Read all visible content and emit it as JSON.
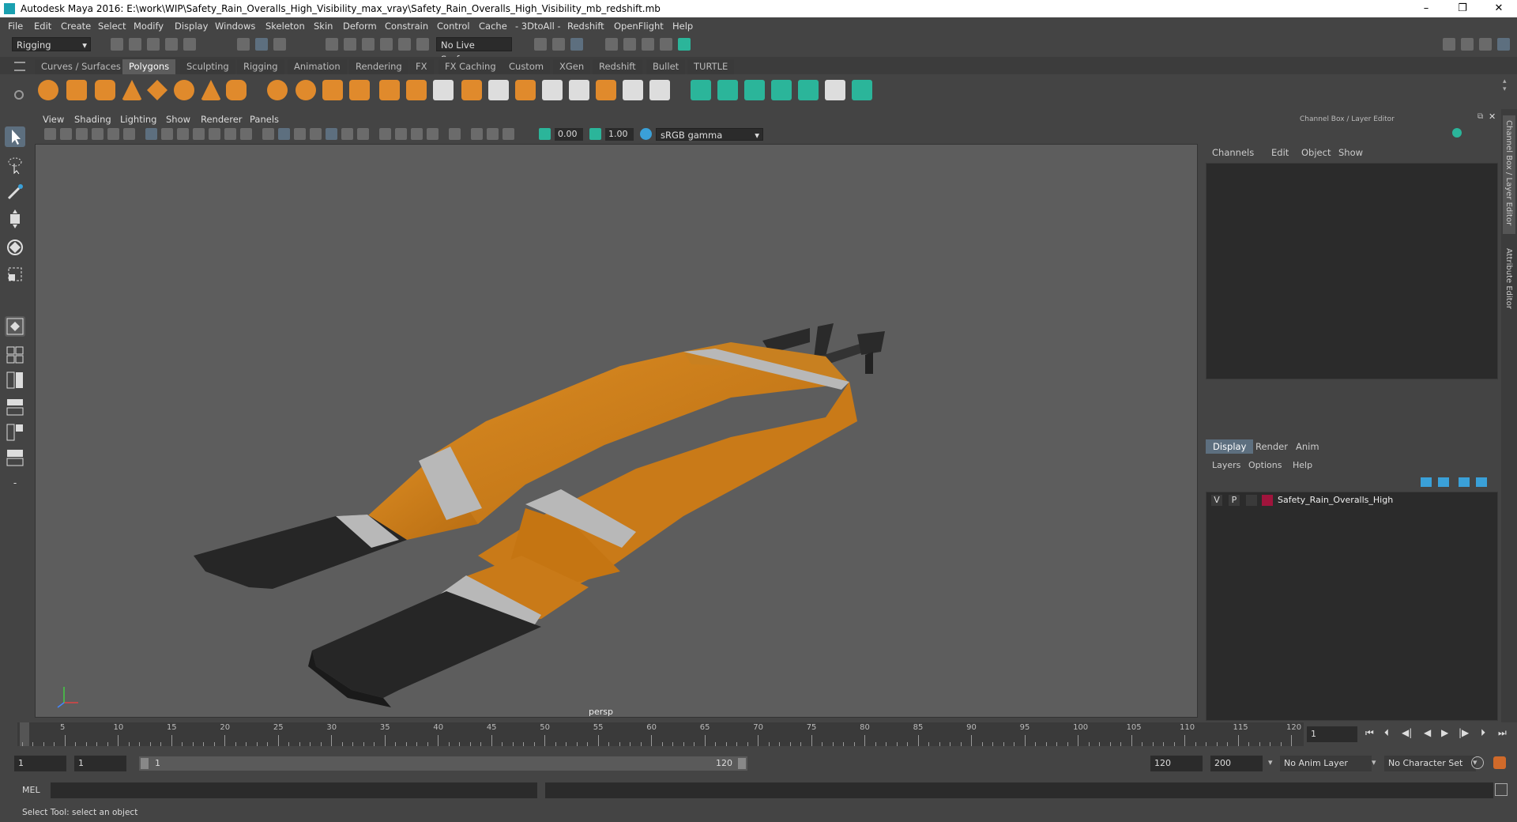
{
  "app": {
    "title": "Autodesk Maya 2016: E:\\work\\WIP\\Safety_Rain_Overalls_High_Visibility_max_vray\\Safety_Rain_Overalls_High_Visibility_mb_redshift.mb",
    "window_controls": [
      "–",
      "❐",
      "✕"
    ]
  },
  "menubar": [
    "File",
    "Edit",
    "Create",
    "Select",
    "Modify",
    "Display",
    "Windows",
    "Skeleton",
    "Skin",
    "Deform",
    "Constrain",
    "Control",
    "Cache",
    "- 3DtoAll -",
    "Redshift",
    "OpenFlight",
    "Help"
  ],
  "statusline": {
    "mode": "Rigging",
    "live_surface": "No Live Surface"
  },
  "shelf": {
    "tabs": [
      "Curves / Surfaces",
      "Polygons",
      "Sculpting",
      "Rigging",
      "Animation",
      "Rendering",
      "FX",
      "FX Caching",
      "Custom",
      "XGen",
      "Redshift",
      "Bullet",
      "TURTLE"
    ],
    "active_tab": "Polygons"
  },
  "viewport": {
    "menu": [
      "View",
      "Shading",
      "Lighting",
      "Show",
      "Renderer",
      "Panels"
    ],
    "exposure": "0.00",
    "gamma": "1.00",
    "color_space": "sRGB gamma",
    "camera": "persp"
  },
  "channel_box": {
    "title": "Channel Box / Layer Editor",
    "menu": [
      "Channels",
      "Edit",
      "Object",
      "Show"
    ]
  },
  "layer_editor": {
    "tabs": [
      "Display",
      "Render",
      "Anim"
    ],
    "active_tab": "Display",
    "menu": [
      "Layers",
      "Options",
      "Help"
    ],
    "layers": [
      {
        "v": "V",
        "p": "P",
        "name": "Safety_Rain_Overalls_High",
        "color": "#a0143c"
      }
    ]
  },
  "side_tabs": [
    "Channel Box / Layer Editor",
    "Attribute Editor"
  ],
  "timeline": {
    "start_label": "1",
    "ticks": [
      "5",
      "10",
      "15",
      "20",
      "25",
      "30",
      "35",
      "40",
      "45",
      "50",
      "55",
      "60",
      "65",
      "70",
      "75",
      "80",
      "85",
      "90",
      "95",
      "100",
      "105",
      "110",
      "115",
      "120"
    ],
    "current_frame": "1"
  },
  "range": {
    "start": "1",
    "anim_start": "1",
    "slider_start": "1",
    "slider_end": "120",
    "anim_end": "120",
    "end": "200",
    "anim_layer": "No Anim Layer",
    "character_set": "No Character Set"
  },
  "command": {
    "label": "MEL"
  },
  "help_line": "Select Tool: select an object",
  "colors": {
    "overalls": "#c97a18",
    "reflective": "#b8b8b8",
    "boot": "#262626",
    "accent": "#5d6f7f"
  }
}
